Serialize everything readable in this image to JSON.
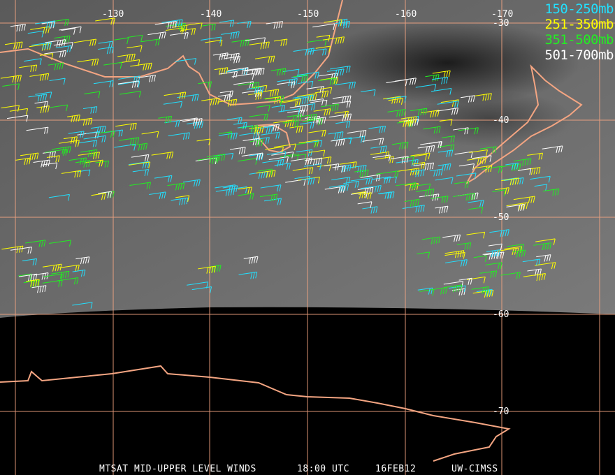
{
  "legend": [
    {
      "label": "150-250mb",
      "color": "#22e0ff"
    },
    {
      "label": "251-350mb",
      "color": "#ffff00"
    },
    {
      "label": "351-500mb",
      "color": "#22ee22"
    },
    {
      "label": "501-700mb",
      "color": "#ffffff"
    }
  ],
  "longitude_labels": [
    "-130",
    "-140",
    "-150",
    "-160",
    "-170"
  ],
  "latitude_labels": [
    "-30",
    "-40",
    "-50",
    "-60",
    "-70"
  ],
  "footer": {
    "title": "MTSAT MID-UPPER LEVEL WINDS",
    "time": "18:00 UTC",
    "date": "16FEB12",
    "source": "UW-CIMSS"
  },
  "colors": {
    "grid": "#f4a582",
    "coast": "#f4a582"
  }
}
